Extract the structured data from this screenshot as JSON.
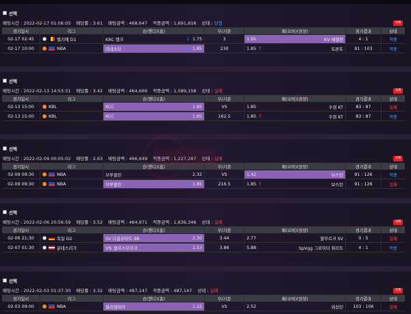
{
  "labels": {
    "select": "선택",
    "bet_time": "배팅시간",
    "odds": "배당률",
    "bet_amount": "배팅금액",
    "win_amount": "적중금액",
    "status": "상태",
    "delete": "삭제"
  },
  "columns": [
    "경기일시",
    "리그",
    "승(핸디)(홈)",
    "무/기준",
    "패(오버)(원정)",
    "경기결과",
    "상태"
  ],
  "bets": [
    {
      "bet_time": "2022-02-17 01:06:05",
      "odds": "3.61",
      "bet_amount": "468,647",
      "win_amount": "1,691,816",
      "status": "당첨",
      "status_type": "win",
      "rows": [
        {
          "date": "02-17 02:45",
          "sport": "soccer",
          "flag": "be",
          "league": "벨기에 D1",
          "home": "KRC 헹크",
          "home_odds": "1.75",
          "home_arrow": "down",
          "home_sel": false,
          "hc": "3",
          "away_odds": "1.95",
          "away_arrow": "up",
          "away": "KV 메헬렌",
          "away_sel": true,
          "result": "4 : 1",
          "status": "적중",
          "status_type": "win"
        },
        {
          "date": "02-17 10:00",
          "sport": "basketball",
          "flag": "us",
          "league": "NBA",
          "home": "미네소타",
          "home_odds": "1.85",
          "home_arrow": "down",
          "home_sel": true,
          "hc": "230",
          "away_odds": "1.85",
          "away_arrow": "up",
          "away": "토론토",
          "away_sel": false,
          "result": "91 : 103",
          "status": "적중",
          "status_type": "win"
        }
      ]
    },
    {
      "bet_time": "2022-02-13 14:53:31",
      "odds": "3.42",
      "bet_amount": "464,666",
      "win_amount": "1,589,158",
      "status": "실패",
      "status_type": "lose",
      "rows": [
        {
          "date": "02-13 15:00",
          "sport": "basketball",
          "flag": "",
          "league": "KBL",
          "home": "KCC",
          "home_odds": "1.85",
          "home_arrow": "",
          "home_sel": true,
          "hc": "VS",
          "away_odds": "1.85",
          "away_arrow": "",
          "away": "수원 KT",
          "away_sel": false,
          "result": "83 : 87",
          "status": "실패",
          "status_type": "lose"
        },
        {
          "date": "02-13 15:00",
          "sport": "basketball",
          "flag": "",
          "league": "KBL",
          "home": "KCC",
          "home_odds": "1.85",
          "home_arrow": "down",
          "home_sel": true,
          "hc": "162.5",
          "away_odds": "1.85",
          "away_arrow": "up",
          "away": "수원 KT",
          "away_sel": false,
          "result": "83 : 87",
          "status": "적중",
          "status_type": "win"
        }
      ]
    },
    {
      "bet_time": "2022-02-09 00:05:02",
      "odds": "2.63",
      "bet_amount": "466,649",
      "win_amount": "1,227,287",
      "status": "실패",
      "status_type": "lose",
      "rows": [
        {
          "date": "02-09 09:30",
          "sport": "basketball",
          "flag": "us",
          "league": "NBA",
          "home": "브루클린",
          "home_odds": "2.32",
          "home_arrow": "",
          "home_sel": false,
          "hc": "VS",
          "away_odds": "1.42",
          "away_arrow": "",
          "away": "보스턴",
          "away_sel": true,
          "result": "91 : 126",
          "status": "적중",
          "status_type": "win"
        },
        {
          "date": "02-09 09:30",
          "sport": "basketball",
          "flag": "us",
          "league": "NBA",
          "home": "브루클린",
          "home_odds": "1.85",
          "home_arrow": "down",
          "home_sel": true,
          "hc": "216.5",
          "away_odds": "1.85",
          "away_arrow": "up",
          "away": "보스턴",
          "away_sel": false,
          "result": "91 : 126",
          "status": "실패",
          "status_type": "lose"
        }
      ]
    },
    {
      "bet_time": "2022-02-06 20:56:59",
      "odds": "3.52",
      "bet_amount": "464,871",
      "win_amount": "1,636,346",
      "status": "실패",
      "status_type": "lose",
      "rows": [
        {
          "date": "02-06 21:30",
          "sport": "soccer",
          "flag": "de",
          "league": "독일 D2",
          "home": "SV 다름슈타트 98",
          "home_odds": "2.30",
          "home_arrow": "",
          "home_sel": true,
          "hc": "3.44",
          "away_odds": "2.77",
          "away_arrow": "",
          "away": "할부르크 SV",
          "away_sel": false,
          "result": "0 : 5",
          "status": "실패",
          "status_type": "lose"
        },
        {
          "date": "02-07 01:30",
          "sport": "soccer",
          "flag": "at",
          "league": "분데스리가",
          "home": "VfL 볼프스부르크",
          "home_odds": "1.53",
          "home_arrow": "",
          "home_sel": true,
          "hc": "3.86",
          "away_odds": "5.88",
          "away_arrow": "",
          "away": "SpVgg 그로이터 퓌르트",
          "away_sel": false,
          "result": "4 : 1",
          "status": "적중",
          "status_type": "win"
        }
      ]
    },
    {
      "bet_time": "2022-02-03 01:37:30",
      "odds": "3.32",
      "bet_amount": "487,147",
      "win_amount": "487,147",
      "status": "실패",
      "status_type": "lose",
      "rows": [
        {
          "date": "02-03 09:00",
          "sport": "basketball",
          "flag": "us",
          "league": "NBA",
          "home": "필라델피아",
          "home_odds": "1.22",
          "home_arrow": "",
          "home_sel": true,
          "hc": "VS",
          "away_odds": "2.52",
          "away_arrow": "",
          "away": "워싱턴",
          "away_sel": false,
          "result": "103 : 106",
          "status": "실패",
          "status_type": "lose"
        }
      ]
    }
  ]
}
